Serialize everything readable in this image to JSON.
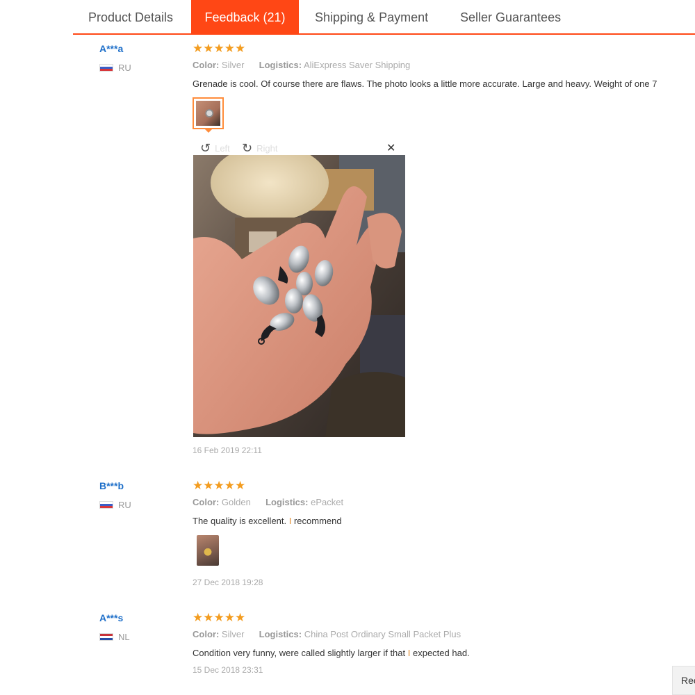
{
  "tabs": [
    {
      "label": "Product Details",
      "active": false
    },
    {
      "label": "Feedback (21)",
      "active": true
    },
    {
      "label": "Shipping & Payment",
      "active": false
    },
    {
      "label": "Seller Guarantees",
      "active": false
    }
  ],
  "reviews": [
    {
      "user": "A***a",
      "country": "RU",
      "stars": "★★★★★",
      "rating": 5,
      "color_label": "Color:",
      "color": "Silver",
      "logistics_label": "Logistics:",
      "logistics": "AliExpress Saver Shipping",
      "text": "Grenade is cool. Of course there are flaws. The photo looks a little more accurate. Large and heavy. Weight of one 7",
      "date": "16 Feb 2019 22:11"
    },
    {
      "user": "B***b",
      "country": "RU",
      "stars": "★★★★★",
      "rating": 5,
      "color_label": "Color:",
      "color": "Golden",
      "logistics_label": "Logistics:",
      "logistics": "ePacket",
      "text_a": "The quality is excellent. ",
      "text_i": "I",
      "text_b": " recommend",
      "date": "27 Dec 2018 19:28"
    },
    {
      "user": "A***s",
      "country": "NL",
      "stars": "★★★★★",
      "rating": 5,
      "color_label": "Color:",
      "color": "Silver",
      "logistics_label": "Logistics:",
      "logistics": "China Post Ordinary Small Packet Plus",
      "text_a": "Condition very funny, were called slightly larger if that ",
      "text_i": "I",
      "text_b": " expected had.",
      "date": "15 Dec 2018 23:31"
    }
  ],
  "viewer": {
    "rotate_left_label": "Left",
    "rotate_right_label": "Right",
    "close_glyph": "✕",
    "rotate_left_icon": "↺",
    "rotate_right_icon": "↻"
  },
  "edge_button": {
    "label": "Rec"
  },
  "colors": {
    "accent": "#ff4715",
    "star": "#f39c1f",
    "link": "#1e6fc9"
  }
}
